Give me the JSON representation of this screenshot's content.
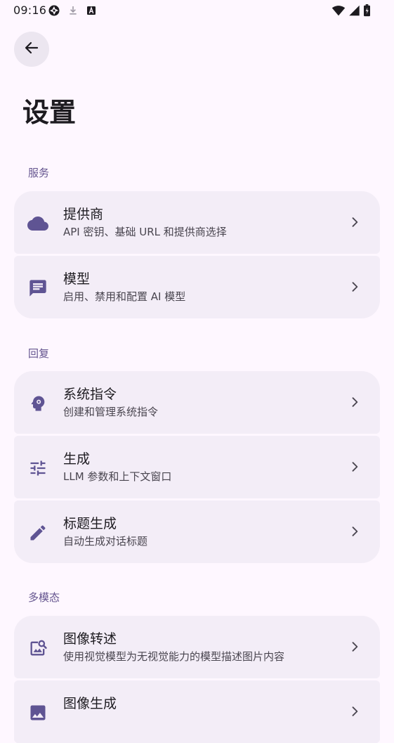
{
  "status_bar": {
    "time": "09:16",
    "left_icons": [
      "aperture-icon",
      "download-icon",
      "font-a-icon"
    ],
    "right_icons": [
      "wifi-icon",
      "signal-icon",
      "battery-icon"
    ]
  },
  "header": {
    "title": "设置"
  },
  "sections": {
    "services": {
      "label": "服务",
      "items": [
        {
          "title": "提供商",
          "subtitle": "API 密钥、基础 URL 和提供商选择",
          "icon": "cloud-icon"
        },
        {
          "title": "模型",
          "subtitle": "启用、禁用和配置 AI 模型",
          "icon": "chat-icon"
        }
      ]
    },
    "reply": {
      "label": "回复",
      "items": [
        {
          "title": "系统指令",
          "subtitle": "创建和管理系统指令",
          "icon": "psychology-icon"
        },
        {
          "title": "生成",
          "subtitle": "LLM 参数和上下文窗口",
          "icon": "tune-icon"
        },
        {
          "title": "标题生成",
          "subtitle": "自动生成对话标题",
          "icon": "pencil-icon"
        }
      ]
    },
    "multimodal": {
      "label": "多模态",
      "items": [
        {
          "title": "图像转述",
          "subtitle": "使用视觉模型为无视觉能力的模型描述图片内容",
          "icon": "image-search-icon"
        },
        {
          "title": "图像生成",
          "subtitle": "",
          "icon": "image-icon"
        }
      ]
    }
  },
  "colors": {
    "background": "#FEF7FF",
    "surface": "#F3EDF7",
    "accent": "#65558F",
    "icon": "#5F5493",
    "on_surface": "#1D1B20",
    "on_surface_variant": "#49454F"
  }
}
